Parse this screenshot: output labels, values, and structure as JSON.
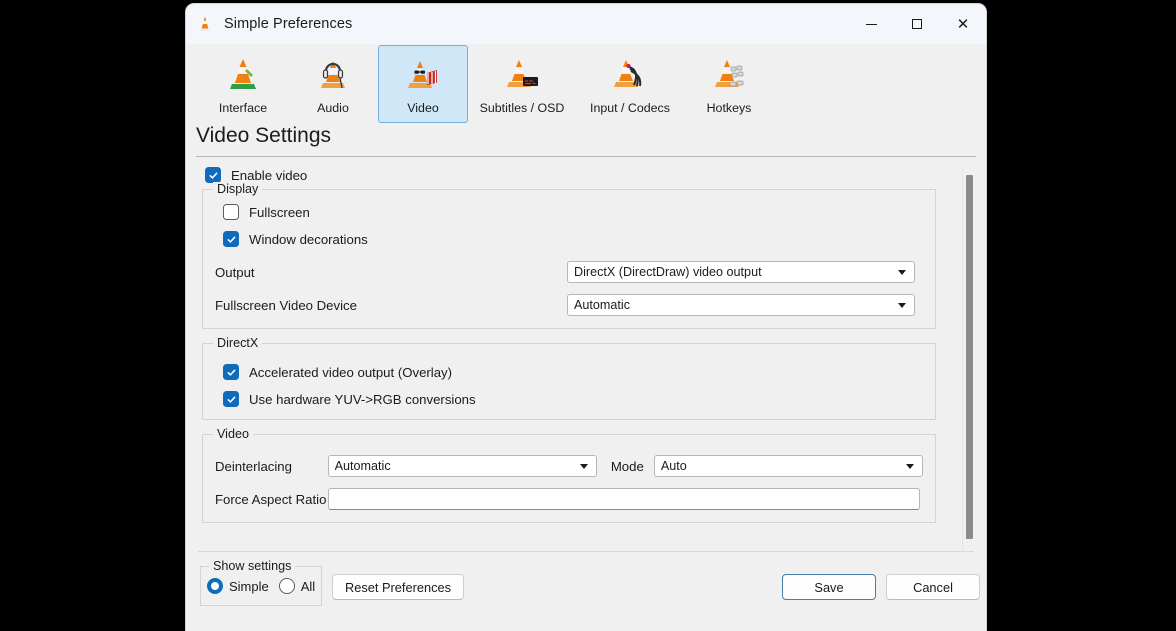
{
  "window": {
    "title": "Simple Preferences",
    "icon": "vlc-cone-icon",
    "controls": {
      "minimize": "minimize-button",
      "maximize": "maximize-button",
      "close": "close-button"
    }
  },
  "tabs": [
    {
      "id": "interface",
      "label": "Interface",
      "icon": "vlc-interface-icon",
      "selected": false
    },
    {
      "id": "audio",
      "label": "Audio",
      "icon": "vlc-audio-icon",
      "selected": false
    },
    {
      "id": "video",
      "label": "Video",
      "icon": "vlc-video-icon",
      "selected": true
    },
    {
      "id": "subtitles",
      "label": "Subtitles / OSD",
      "icon": "vlc-subtitles-icon",
      "selected": false
    },
    {
      "id": "input",
      "label": "Input / Codecs",
      "icon": "vlc-input-codecs-icon",
      "selected": false
    },
    {
      "id": "hotkeys",
      "label": "Hotkeys",
      "icon": "vlc-hotkeys-icon",
      "selected": false
    }
  ],
  "page": {
    "title": "Video Settings"
  },
  "enable_video": {
    "label": "Enable video",
    "checked": true
  },
  "display_group": {
    "legend": "Display",
    "fullscreen": {
      "label": "Fullscreen",
      "checked": false
    },
    "window_decorations": {
      "label": "Window decorations",
      "checked": true
    },
    "output": {
      "label": "Output",
      "value": "DirectX (DirectDraw) video output"
    },
    "fullscreen_video_device": {
      "label": "Fullscreen Video Device",
      "value": "Automatic"
    }
  },
  "directx_group": {
    "legend": "DirectX",
    "accelerated": {
      "label": "Accelerated video output (Overlay)",
      "checked": true
    },
    "yuv_rgb": {
      "label": "Use hardware YUV->RGB conversions",
      "checked": true
    }
  },
  "video_group": {
    "legend": "Video",
    "deinterlacing": {
      "label": "Deinterlacing",
      "value": "Automatic"
    },
    "mode": {
      "label": "Mode",
      "value": "Auto"
    },
    "force_aspect_ratio": {
      "label": "Force Aspect Ratio",
      "value": "",
      "placeholder": ""
    }
  },
  "show_settings": {
    "legend": "Show settings",
    "options": [
      {
        "label": "Simple",
        "selected": true
      },
      {
        "label": "All",
        "selected": false
      }
    ]
  },
  "buttons": {
    "reset": "Reset Preferences",
    "save": "Save",
    "cancel": "Cancel"
  },
  "scrollbar": {
    "name": "vertical-scrollbar"
  },
  "colors": {
    "accent": "#0f6cbd",
    "tab_selected_bg": "#cfe7f7",
    "tab_selected_border": "#6fb3dd",
    "window_bg": "#f0f0f0",
    "titlebar_bg": "#f3f6fb"
  }
}
